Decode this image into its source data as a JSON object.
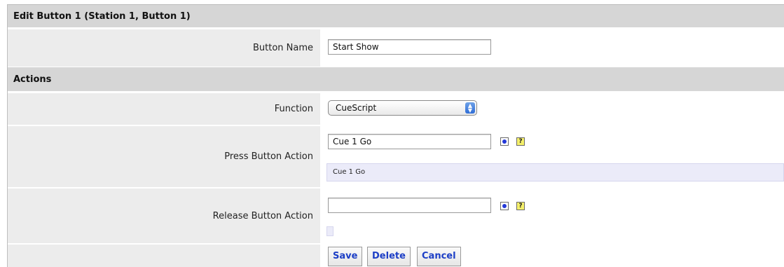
{
  "edit_header": {
    "title": "Edit Button 1 (Station 1, Button 1)"
  },
  "button_name": {
    "label": "Button Name",
    "value": "Start Show"
  },
  "actions_header": {
    "title": "Actions"
  },
  "function": {
    "label": "Function",
    "selected": "CueScript"
  },
  "press_action": {
    "label": "Press Button Action",
    "value": "Cue 1 Go",
    "preview": "Cue 1 Go"
  },
  "release_action": {
    "label": "Release Button Action",
    "value": "",
    "preview": ""
  },
  "buttons": {
    "save": "Save",
    "delete": "Delete",
    "cancel": "Cancel"
  },
  "icons": {
    "pick": "cue-picker-icon",
    "help": "help-icon",
    "help_glyph": "?"
  }
}
